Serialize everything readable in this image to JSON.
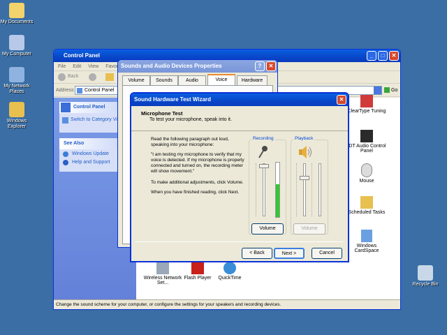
{
  "desktop": {
    "icons": [
      {
        "label": "My Documents"
      },
      {
        "label": "My Computer"
      },
      {
        "label": "My Network Places"
      },
      {
        "label": "Windows Explorer"
      },
      {
        "label": "Recycle Bin"
      }
    ]
  },
  "control_panel": {
    "title": "Control Panel",
    "menu": [
      "File",
      "Edit",
      "View",
      "Favori"
    ],
    "back_label": "Back",
    "address_label": "Address",
    "address_value": "Control Panel",
    "go_label": "Go",
    "side_title": "Control Panel",
    "switch_category": "Switch to Category View",
    "see_also": "See Also",
    "windows_update": "Windows Update",
    "help_support": "Help and Support",
    "right_items": [
      "ClearType Tuning",
      "IDT Audio Control Panel",
      "Mouse",
      "Scheduled Tasks",
      "Windows CardSpace"
    ],
    "bottom_items": [
      "Wireless Network Set...",
      "Flash Player",
      "QuickTime"
    ],
    "status": "Change the sound scheme for your computer, or configure the settings for your speakers and recording devices."
  },
  "sounds_dialog": {
    "title": "Sounds and Audio Devices Properties",
    "tabs": [
      "Volume",
      "Sounds",
      "Audio",
      "Voice",
      "Hardware"
    ],
    "active_tab": "Voice"
  },
  "wizard": {
    "title": "Sound Hardware Test Wizard",
    "heading": "Microphone Test",
    "subheading": "To test your microphone, speak into it.",
    "para1": "Read the following paragraph out loud, speaking into your microphone:",
    "para2": "\"I am testing my microphone to verify that my voice is detected. If my microphone is properly connected and turned on, the recording meter will show movement.\"",
    "para3": "To make additional adjustments, click Volume.",
    "para4": "When you have finished reading, click Next.",
    "recording_label": "Recording",
    "playback_label": "Playback",
    "volume_btn": "Volume",
    "back_btn": "< Back",
    "next_btn": "Next >",
    "cancel_btn": "Cancel",
    "recording_level": 0.6
  }
}
